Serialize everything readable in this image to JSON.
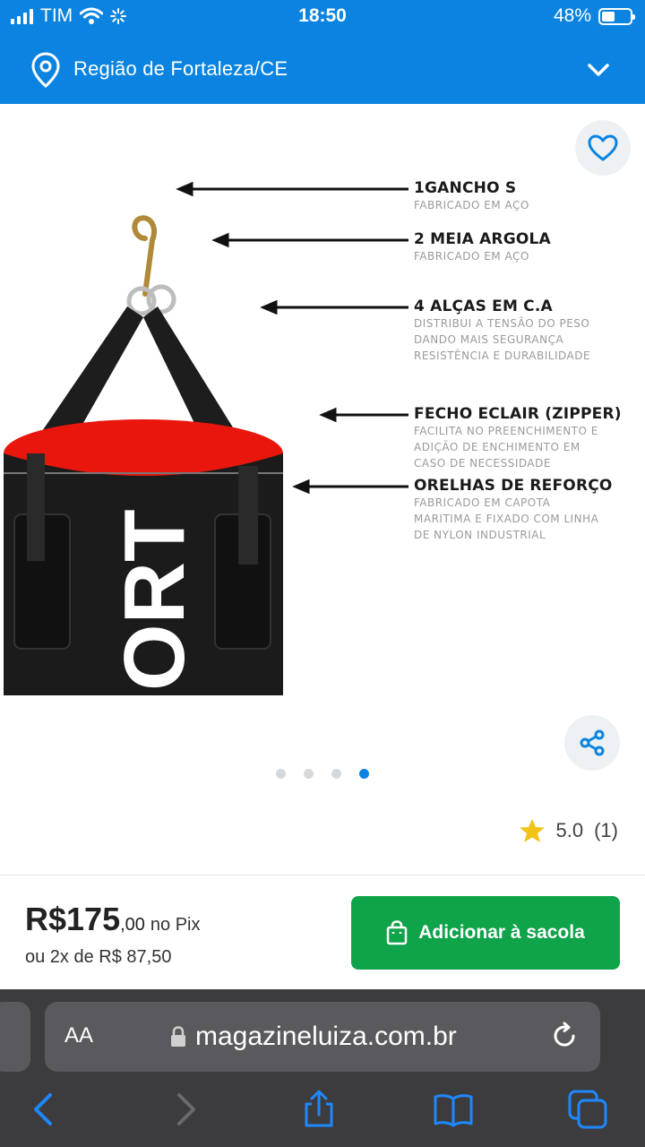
{
  "status_bar": {
    "carrier": "TIM",
    "time": "18:50",
    "battery": "48%",
    "battery_level": 0.48
  },
  "header": {
    "location": "Região de Fortaleza/CE"
  },
  "product_image": {
    "brand_text": "ORT",
    "annotations": [
      {
        "title": "1GANCHO S",
        "desc": [
          "FABRICADO EM AÇO"
        ]
      },
      {
        "title": "2 MEIA ARGOLA",
        "desc": [
          "FABRICADO EM AÇO"
        ]
      },
      {
        "title": "4 ALÇAS EM C.A",
        "desc": [
          "DISTRIBUI A TENSÃO DO PESO",
          "DANDO MAIS SEGURANÇA",
          "RESISTÊNCIA E DURABILIDADE"
        ]
      },
      {
        "title": "FECHO ECLAIR (ZIPPER)",
        "desc": [
          "FACILITA NO PREENCHIMENTO E",
          "ADIÇÃO DE ENCHIMENTO EM",
          "CASO DE NECESSIDADE"
        ]
      },
      {
        "title": "ORELHAS DE REFORÇO",
        "desc": [
          "FABRICADO EM CAPOTA",
          "MARITIMA E FIXADO COM LINHA",
          "DE NYLON INDUSTRIAL"
        ]
      }
    ],
    "carousel_total": 4,
    "carousel_active": 4
  },
  "rating": {
    "value": "5.0",
    "count": "(1)"
  },
  "purchase": {
    "price_int": "R$175",
    "price_cents": ",00",
    "pix_label": "no Pix",
    "installment": "ou 2x de R$ 87,50",
    "add_button": "Adicionar à sacola"
  },
  "browser": {
    "aa_label": "AA",
    "url": "magazineluiza.com.br"
  },
  "colors": {
    "brand_blue": "#0a84e0",
    "buy_green": "#0fa34a",
    "star": "#f2c418"
  }
}
